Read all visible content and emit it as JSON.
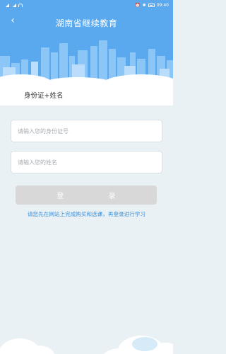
{
  "status_bar": {
    "time": "09:40",
    "battery_level": 0.2
  },
  "header": {
    "title": "湖南省继续教育",
    "back_icon": "chevron-left-icon"
  },
  "tab": {
    "label": "身份证+姓名"
  },
  "form": {
    "id_placeholder": "请输入您的身份证号",
    "name_placeholder": "请输入您的姓名",
    "login_label": "登 录"
  },
  "hint": "请您先在网站上完成购买和选课，再登录进行学习",
  "colors": {
    "header_blue": "#5aa9ef",
    "page_bg": "#eaf1f5",
    "hint_blue": "#3a8ed4",
    "button_disabled": "#d8d8d8"
  }
}
